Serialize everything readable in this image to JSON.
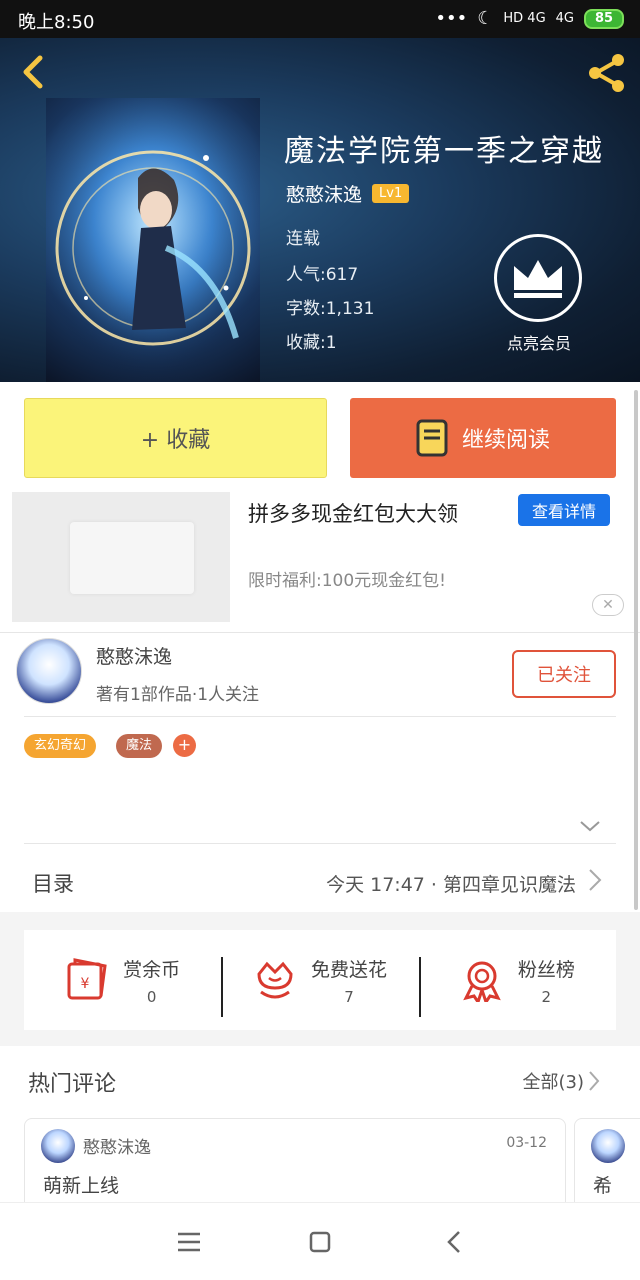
{
  "status_bar": {
    "time": "晚上8:50",
    "signal1": "HD 4G",
    "signal2": "4G",
    "battery": "85"
  },
  "book": {
    "title": "魔法学院第一季之穿越",
    "author": "憨憨沫逸",
    "level": "Lv1",
    "status": "连载",
    "popularity": "人气:617",
    "word_count": "字数:1,131",
    "favorites": "收藏:1",
    "vip_label": "点亮会员"
  },
  "actions": {
    "favorite": "+ 收藏",
    "continue_reading": "继续阅读"
  },
  "ad": {
    "title": "拼多多现金红包大大领",
    "button": "查看详情",
    "subtitle": "限时福利:100元现金红包!",
    "close": "✕"
  },
  "author_card": {
    "name": "憨憨沫逸",
    "stats": "著有1部作品·1人关注",
    "follow": "已关注"
  },
  "tags": [
    {
      "label": "玄幻奇幻",
      "color": "#f5a531"
    },
    {
      "label": "魔法",
      "color": "#c0694f"
    }
  ],
  "tag_add": "+",
  "toc": {
    "label": "目录",
    "latest": "今天 17:47 · 第四章见识魔法"
  },
  "rewards": [
    {
      "name": "赏余币",
      "count": "0",
      "icon": "red-envelope-icon"
    },
    {
      "name": "免费送花",
      "count": "7",
      "icon": "flower-icon"
    },
    {
      "name": "粉丝榜",
      "count": "2",
      "icon": "medal-icon"
    }
  ],
  "comments": {
    "title": "热门评论",
    "all": "全部(3)",
    "items": [
      {
        "user": "憨憨沫逸",
        "date": "03-12",
        "text": "萌新上线"
      }
    ],
    "next_preview": "希"
  },
  "colors": {
    "accent_orange": "#ec6b44",
    "yellow_button": "#fbf47a",
    "badge_yellow": "#f7b730",
    "link_blue": "#1a73e8"
  }
}
